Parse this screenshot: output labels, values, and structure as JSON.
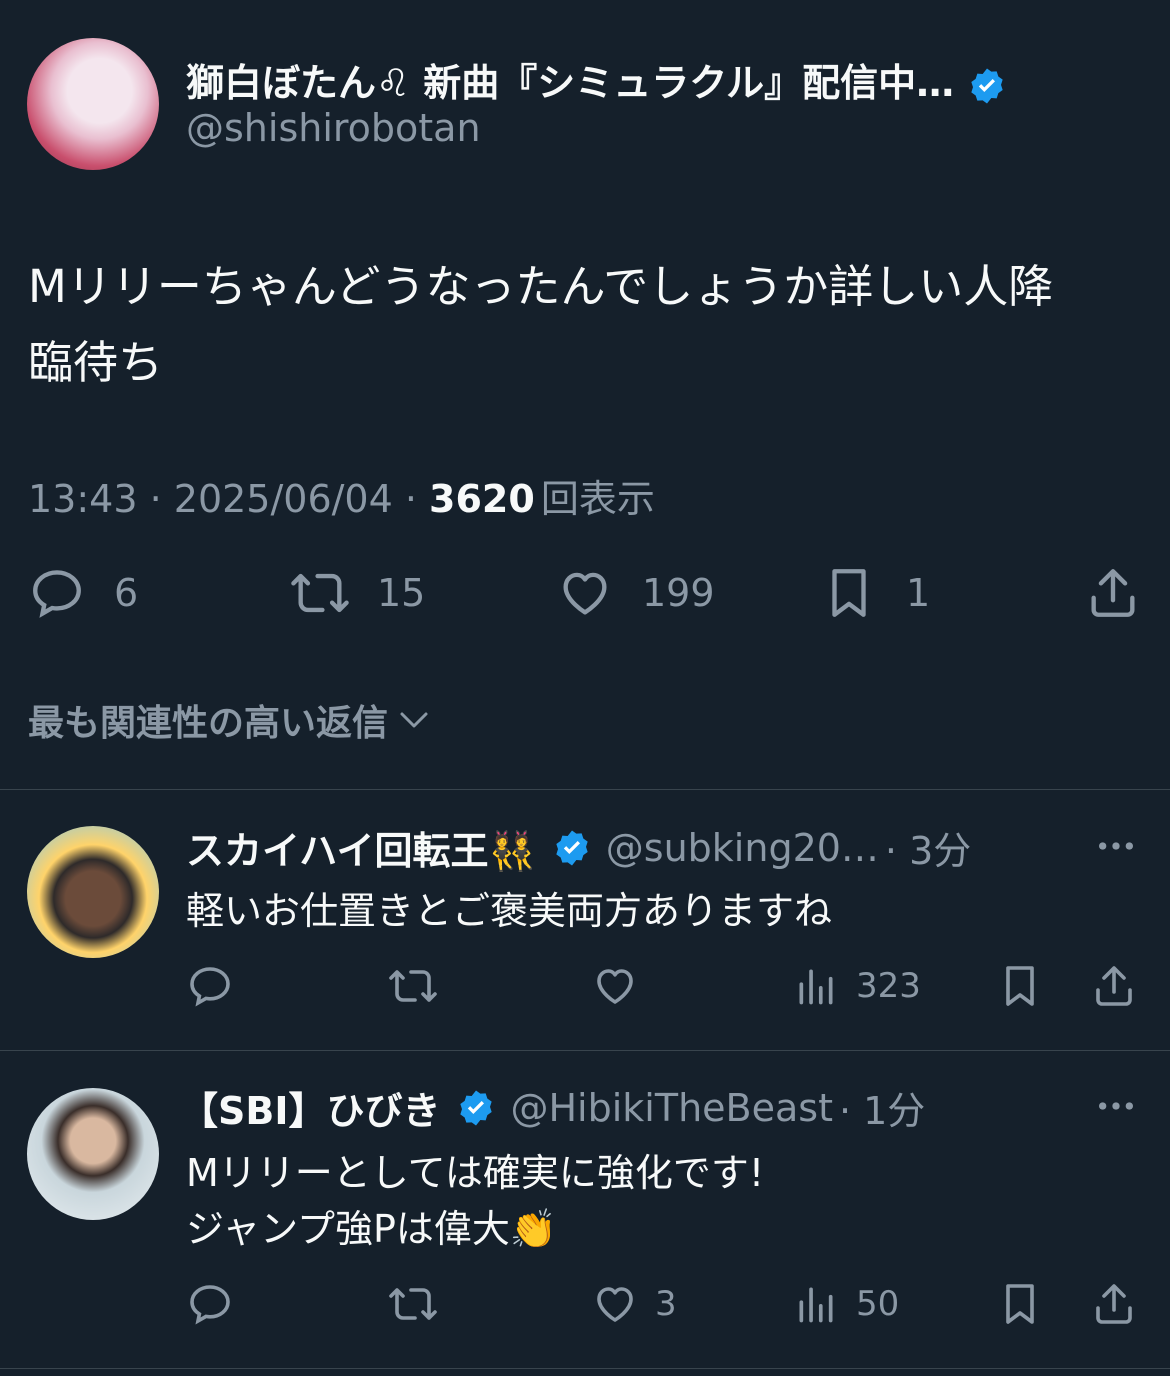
{
  "main_tweet": {
    "display_name": "獅白ぼたん♌ 新曲『シミュラクル』配信中…",
    "handle": "@shishirobotan",
    "text_line1": "Mリリーちゃんどうなったんでしょうか詳しい人降",
    "text_line2": "臨待ち",
    "time": "13:43",
    "sep1": " · ",
    "date": "2025/06/04",
    "sep2": " · ",
    "views_count": "3620",
    "views_label": "回表示",
    "replies": "6",
    "retweets": "15",
    "likes": "199",
    "bookmarks": "1"
  },
  "sort_selector": {
    "label": "最も関連性の高い返信"
  },
  "replies": [
    {
      "display_name": "スカイハイ回転王👯",
      "handle": "@subking20…",
      "time": "· 3分",
      "text": "軽いお仕置きとご褒美両方ありますね",
      "likes": "",
      "views": "323"
    },
    {
      "display_name": "【SBI】ひびき",
      "handle": "@HibikiTheBeast",
      "time": "· 1分",
      "text_line1": "Mリリーとしては確実に強化です!",
      "text_line2": "ジャンプ強Pは偉大👏",
      "likes": "3",
      "views": "50"
    }
  ],
  "colors": {
    "background": "#15202b",
    "muted": "#8b98a5",
    "verified": "#1d9bf0",
    "divider": "#38444d"
  }
}
